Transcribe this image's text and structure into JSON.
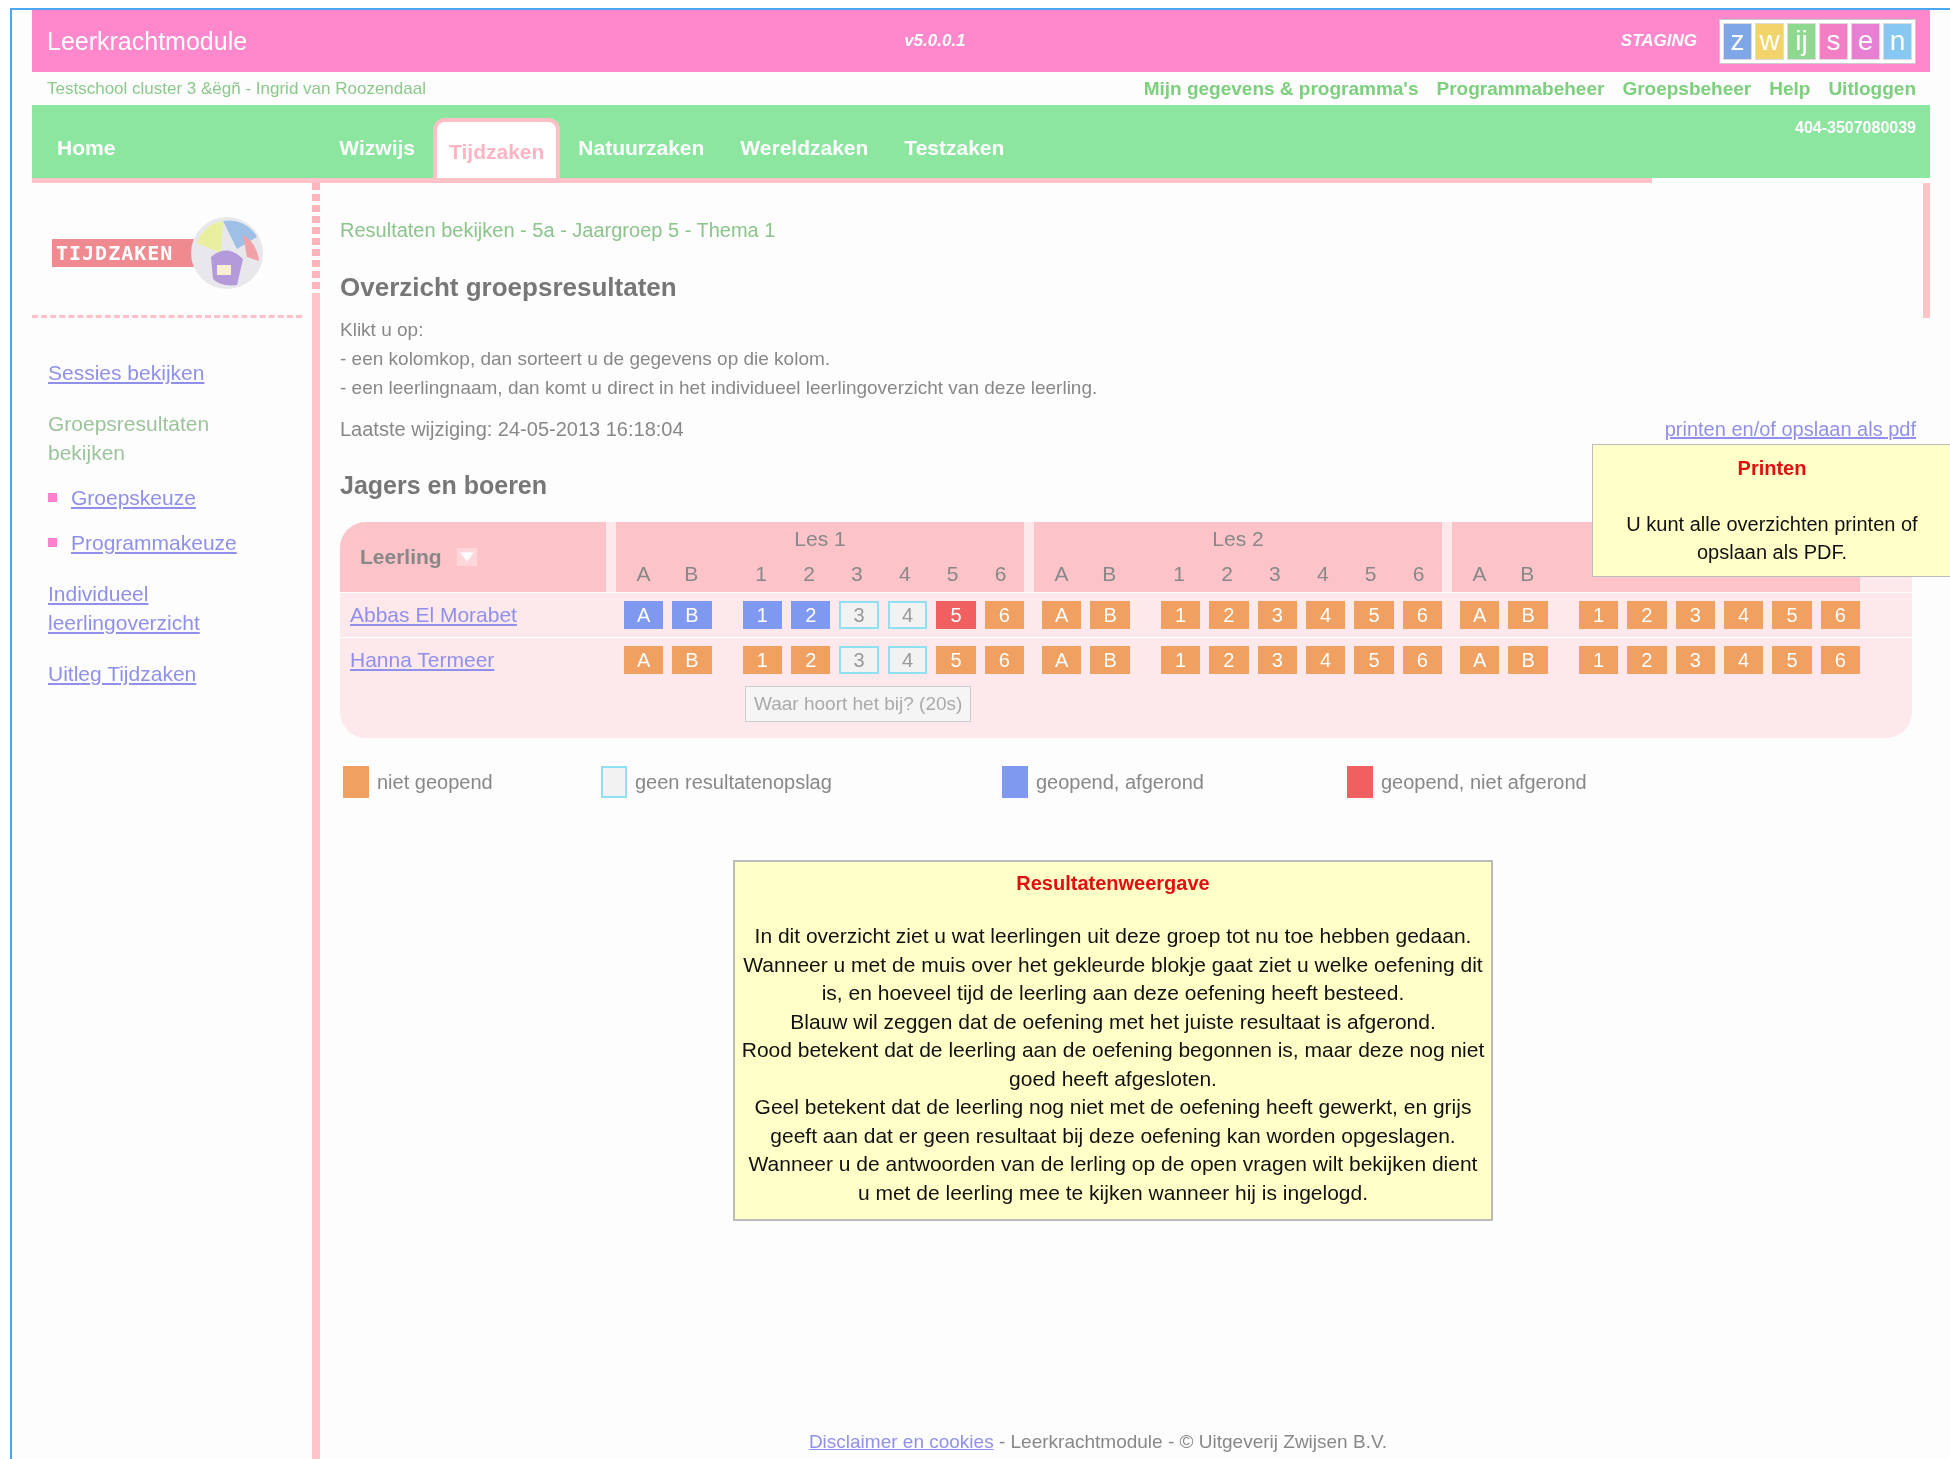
{
  "header": {
    "title": "Leerkrachtmodule",
    "version": "v5.0.0.1",
    "environment": "STAGING",
    "brand_letters": [
      {
        "text": "z",
        "color": "#7fa6e6"
      },
      {
        "text": "w",
        "color": "#f2d46a"
      },
      {
        "text": "ij",
        "color": "#8fd88f"
      },
      {
        "text": "s",
        "color": "#f27fc4"
      },
      {
        "text": "e",
        "color": "#e77fd2"
      },
      {
        "text": "n",
        "color": "#86c8f2"
      }
    ]
  },
  "user_bar": {
    "school": "Testschool cluster 3 &ëgñ - Ingrid van Roozendaal",
    "links": [
      "Mijn gegevens & programma's",
      "Programmabeheer",
      "Groepsbeheer",
      "Help",
      "Uitloggen"
    ]
  },
  "nav": {
    "tabs": [
      {
        "label": "Home",
        "selected": false
      },
      {
        "label": "Wizwijs",
        "selected": false
      },
      {
        "label": "Tijdzaken",
        "selected": true
      },
      {
        "label": "Natuurzaken",
        "selected": false
      },
      {
        "label": "Wereldzaken",
        "selected": false
      },
      {
        "label": "Testzaken",
        "selected": false
      }
    ],
    "code": "404-3507080039"
  },
  "sidebar": {
    "logo_text": "TIJDZAKEN",
    "items": [
      {
        "label": "Sessies bekijken",
        "selected": false
      },
      {
        "label": "Groepsresultaten bekijken",
        "selected": true,
        "children": [
          {
            "label": "Groepskeuze",
            "selected": false
          },
          {
            "label": "Programmakeuze",
            "selected": false
          }
        ]
      },
      {
        "label": "Individueel leerlingoverzicht",
        "selected": false
      },
      {
        "label": "Uitleg Tijdzaken",
        "selected": false
      }
    ]
  },
  "breadcrumb": "Resultaten bekijken - 5a - Jaargroep 5 - Thema 1",
  "heading": "Overzicht groepsresultaten",
  "instructions": [
    "Klikt u op:",
    "- een kolomkop, dan sorteert u de gegevens op die kolom.",
    "- een leerlingnaam, dan komt u direct in het individueel leerlingoverzicht van deze leerling."
  ],
  "last_change": "Laatste wijziging: 24-05-2013 16:18:04",
  "print_link": "printen en/of opslaan als pdf",
  "section_title": "Jagers en boeren",
  "table": {
    "name_column": "Leerling",
    "lessons": [
      {
        "title": "Les 1",
        "columns": [
          "A",
          "B",
          "1",
          "2",
          "3",
          "4",
          "5",
          "6"
        ]
      },
      {
        "title": "Les 2",
        "columns": [
          "A",
          "B",
          "1",
          "2",
          "3",
          "4",
          "5",
          "6"
        ]
      },
      {
        "columns": [
          "A",
          "B"
        ]
      }
    ],
    "rows": [
      {
        "name": "Abbas El Morabet",
        "cells": [
          {
            "text": "A",
            "kind": "done"
          },
          {
            "text": "B",
            "kind": "done"
          },
          {
            "text": "1",
            "kind": "done"
          },
          {
            "text": "2",
            "kind": "done"
          },
          {
            "text": "3",
            "kind": "nostore"
          },
          {
            "text": "4",
            "kind": "nostore"
          },
          {
            "text": "5",
            "kind": "open"
          },
          {
            "text": "6",
            "kind": "unopened"
          },
          {
            "text": "A",
            "kind": "unopened"
          },
          {
            "text": "B",
            "kind": "unopened"
          },
          {
            "text": "1",
            "kind": "unopened"
          },
          {
            "text": "2",
            "kind": "unopened"
          },
          {
            "text": "3",
            "kind": "unopened"
          },
          {
            "text": "4",
            "kind": "unopened"
          },
          {
            "text": "5",
            "kind": "unopened"
          },
          {
            "text": "6",
            "kind": "unopened"
          },
          {
            "text": "A",
            "kind": "unopened"
          },
          {
            "text": "B",
            "kind": "unopened"
          },
          {
            "text": "1",
            "kind": "unopened"
          },
          {
            "text": "2",
            "kind": "unopened"
          },
          {
            "text": "3",
            "kind": "unopened"
          },
          {
            "text": "4",
            "kind": "unopened"
          },
          {
            "text": "5",
            "kind": "unopened"
          },
          {
            "text": "6",
            "kind": "unopened"
          }
        ]
      },
      {
        "name": "Hanna Termeer",
        "cells": [
          {
            "text": "A",
            "kind": "unopened"
          },
          {
            "text": "B",
            "kind": "unopened"
          },
          {
            "text": "1",
            "kind": "unopened"
          },
          {
            "text": "2",
            "kind": "unopened"
          },
          {
            "text": "3",
            "kind": "nostore"
          },
          {
            "text": "4",
            "kind": "nostore"
          },
          {
            "text": "5",
            "kind": "unopened"
          },
          {
            "text": "6",
            "kind": "unopened"
          },
          {
            "text": "A",
            "kind": "unopened"
          },
          {
            "text": "B",
            "kind": "unopened"
          },
          {
            "text": "1",
            "kind": "unopened"
          },
          {
            "text": "2",
            "kind": "unopened"
          },
          {
            "text": "3",
            "kind": "unopened"
          },
          {
            "text": "4",
            "kind": "unopened"
          },
          {
            "text": "5",
            "kind": "unopened"
          },
          {
            "text": "6",
            "kind": "unopened"
          },
          {
            "text": "A",
            "kind": "unopened"
          },
          {
            "text": "B",
            "kind": "unopened"
          },
          {
            "text": "1",
            "kind": "unopened"
          },
          {
            "text": "2",
            "kind": "unopened"
          },
          {
            "text": "3",
            "kind": "unopened"
          },
          {
            "text": "4",
            "kind": "unopened"
          },
          {
            "text": "5",
            "kind": "unopened"
          },
          {
            "text": "6",
            "kind": "unopened"
          }
        ]
      }
    ],
    "hover_tooltip": "Waar hoort het bij? (20s)"
  },
  "print_tooltip": {
    "title": "Printen",
    "text": "U kunt alle overzichten printen of opslaan als PDF."
  },
  "legend": [
    {
      "label": "niet geopend",
      "kind": "unopened"
    },
    {
      "label": "geen resultatenopslag",
      "kind": "nostore"
    },
    {
      "label": "geopend, afgerond",
      "kind": "done"
    },
    {
      "label": "geopend, niet afgerond",
      "kind": "open"
    }
  ],
  "info_box": {
    "title": "Resultatenweergave",
    "paragraphs": [
      "In dit overzicht ziet u wat leerlingen uit deze groep tot nu toe hebben gedaan. Wanneer u met de muis over het gekleurde blokje gaat ziet u welke oefening dit is, en hoeveel tijd de leerling aan deze oefening heeft besteed.",
      "Blauw wil zeggen dat de oefening met het juiste resultaat is afgerond.",
      "Rood betekent dat de leerling aan de oefening begonnen is, maar deze nog niet goed heeft afgesloten.",
      "Geel betekent dat de leerling nog niet met de oefening heeft gewerkt, en grijs geeft aan dat er geen resultaat bij deze oefening kan worden opgeslagen. Wanneer u de antwoorden van de lerling op de open vragen wilt bekijken dient u met de leerling mee te kijken wanneer hij is ingelogd."
    ]
  },
  "footer": {
    "link": "Disclaimer en cookies",
    "text": " - Leerkrachtmodule - © Uitgeverij Zwijsen B.V."
  }
}
